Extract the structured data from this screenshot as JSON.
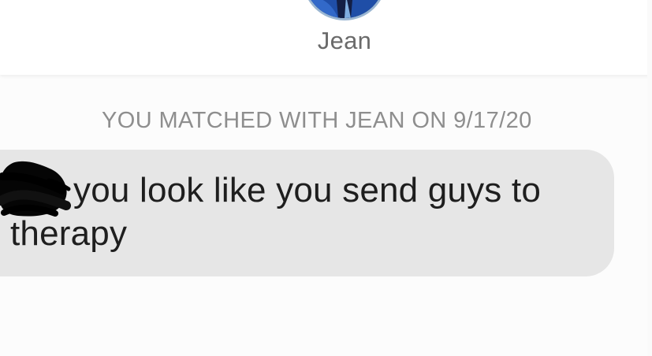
{
  "profile": {
    "name": "Jean",
    "avatar_colors": {
      "ring": "#9ab6d2",
      "fill": "#233a7a"
    }
  },
  "match": {
    "notice": "YOU MATCHED WITH JEAN ON 9/17/20"
  },
  "message": {
    "text": "you look like you send guys to therapy",
    "bubble_color": "#e6e6e6",
    "redaction_icon": "redaction-scribble"
  },
  "colors": {
    "background": "#fcfcfc",
    "header": "#ffffff",
    "notice_text": "#8e8e8e",
    "message_text": "#1e1e1e"
  }
}
